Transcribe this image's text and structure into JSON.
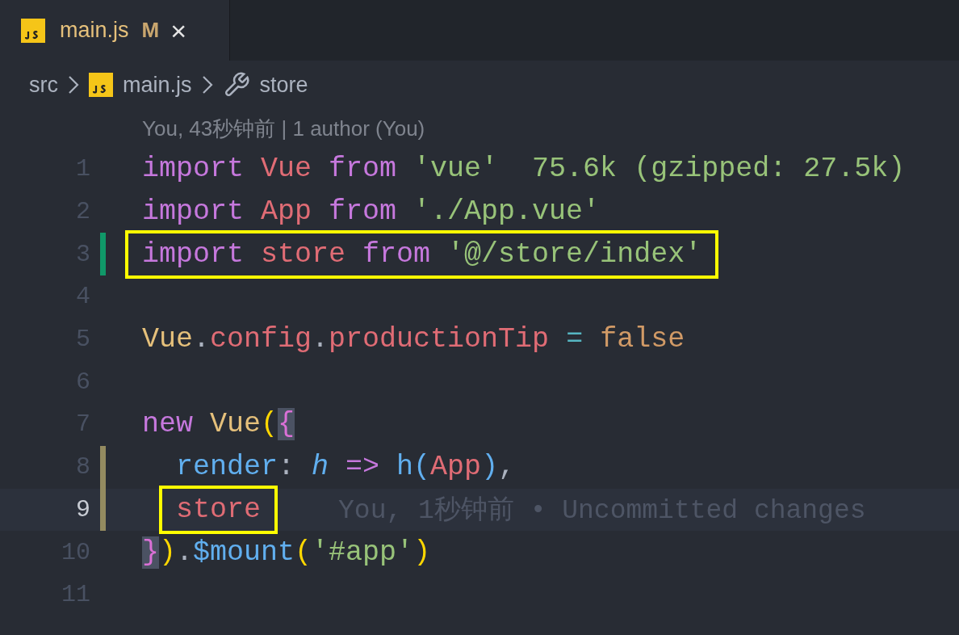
{
  "tab": {
    "label": "main.js",
    "badge": "M",
    "close": "×",
    "selected": true
  },
  "breadcrumbs": [
    {
      "label": "src",
      "kind": "folder"
    },
    {
      "label": "main.js",
      "kind": "jsfile"
    },
    {
      "label": "store",
      "kind": "symbol"
    }
  ],
  "codelens": "You, 43秒钟前 | 1 author (You)",
  "lines": [
    {
      "number": "1",
      "current": false,
      "boxed": false,
      "indented": false,
      "tokens": [
        {
          "text": "import ",
          "kind": "keyword"
        },
        {
          "text": "Vue ",
          "kind": "variable"
        },
        {
          "text": "from ",
          "kind": "keyword"
        },
        {
          "text": "'vue'  ",
          "kind": "string"
        },
        {
          "text": "75.6k (gzipped: 27.5k)",
          "kind": "hint"
        }
      ]
    },
    {
      "number": "2",
      "current": false,
      "boxed": false,
      "indented": false,
      "tokens": [
        {
          "text": "import ",
          "kind": "keyword"
        },
        {
          "text": "App ",
          "kind": "variable"
        },
        {
          "text": "from ",
          "kind": "keyword"
        },
        {
          "text": "'./App.vue'",
          "kind": "string"
        }
      ]
    },
    {
      "number": "3",
      "color": "#109868",
      "current": false,
      "boxed": true,
      "indented": false,
      "tokens": [
        {
          "text": "import ",
          "kind": "keyword"
        },
        {
          "text": "store ",
          "kind": "variable"
        },
        {
          "text": "from ",
          "kind": "keyword"
        },
        {
          "text": "'@/store/index'",
          "kind": "string"
        }
      ]
    },
    {
      "number": "4",
      "current": false,
      "boxed": false,
      "indented": false
    },
    {
      "number": "5",
      "current": false,
      "boxed": false,
      "indented": false,
      "tokens": [
        {
          "text": "Vue",
          "kind": "class"
        },
        {
          "text": ".",
          "kind": "plain"
        },
        {
          "text": "config",
          "kind": "variable"
        },
        {
          "text": ".",
          "kind": "plain"
        },
        {
          "text": "productionTip ",
          "kind": "variable"
        },
        {
          "text": "= ",
          "kind": "operator"
        },
        {
          "text": "false",
          "kind": "constant"
        }
      ]
    },
    {
      "number": "6",
      "current": false,
      "boxed": false,
      "indented": false
    },
    {
      "number": "7",
      "current": false,
      "boxed": false,
      "indented": false,
      "tokens": [
        {
          "text": "new ",
          "kind": "keyword"
        },
        {
          "text": "Vue",
          "kind": "class"
        },
        {
          "text": "(",
          "kind": "paren"
        },
        {
          "text": "{",
          "kind": "brace",
          "matched": true
        }
      ]
    },
    {
      "number": "8",
      "color": "#948b60",
      "current": false,
      "boxed": false,
      "indented": true,
      "tokens": [
        {
          "text": "render",
          "kind": "function"
        },
        {
          "text": ": ",
          "kind": "plain"
        },
        {
          "text": "h ",
          "kind": "param"
        },
        {
          "text": "=> ",
          "kind": "keyword"
        },
        {
          "text": "h",
          "kind": "function"
        },
        {
          "text": "(",
          "kind": "paren2"
        },
        {
          "text": "App",
          "kind": "variable"
        },
        {
          "text": ")",
          "kind": "paren2"
        },
        {
          "text": ",",
          "kind": "plain"
        }
      ]
    },
    {
      "number": "9",
      "color": "#948b60",
      "current": true,
      "boxed": true,
      "indented": true,
      "blame": "You, 1秒钟前 • Uncommitted changes",
      "tokens": [
        {
          "text": "store",
          "kind": "variable"
        }
      ]
    },
    {
      "number": "10",
      "current": false,
      "boxed": false,
      "indented": false,
      "tokens": [
        {
          "text": "}",
          "kind": "brace",
          "matched": true
        },
        {
          "text": ")",
          "kind": "paren"
        },
        {
          "text": ".",
          "kind": "plain"
        },
        {
          "text": "$mount",
          "kind": "function"
        },
        {
          "text": "(",
          "kind": "paren"
        },
        {
          "text": "'#app'",
          "kind": "string"
        },
        {
          "text": ")",
          "kind": "paren"
        }
      ]
    },
    {
      "number": "11",
      "current": false,
      "boxed": false,
      "indented": false
    }
  ]
}
